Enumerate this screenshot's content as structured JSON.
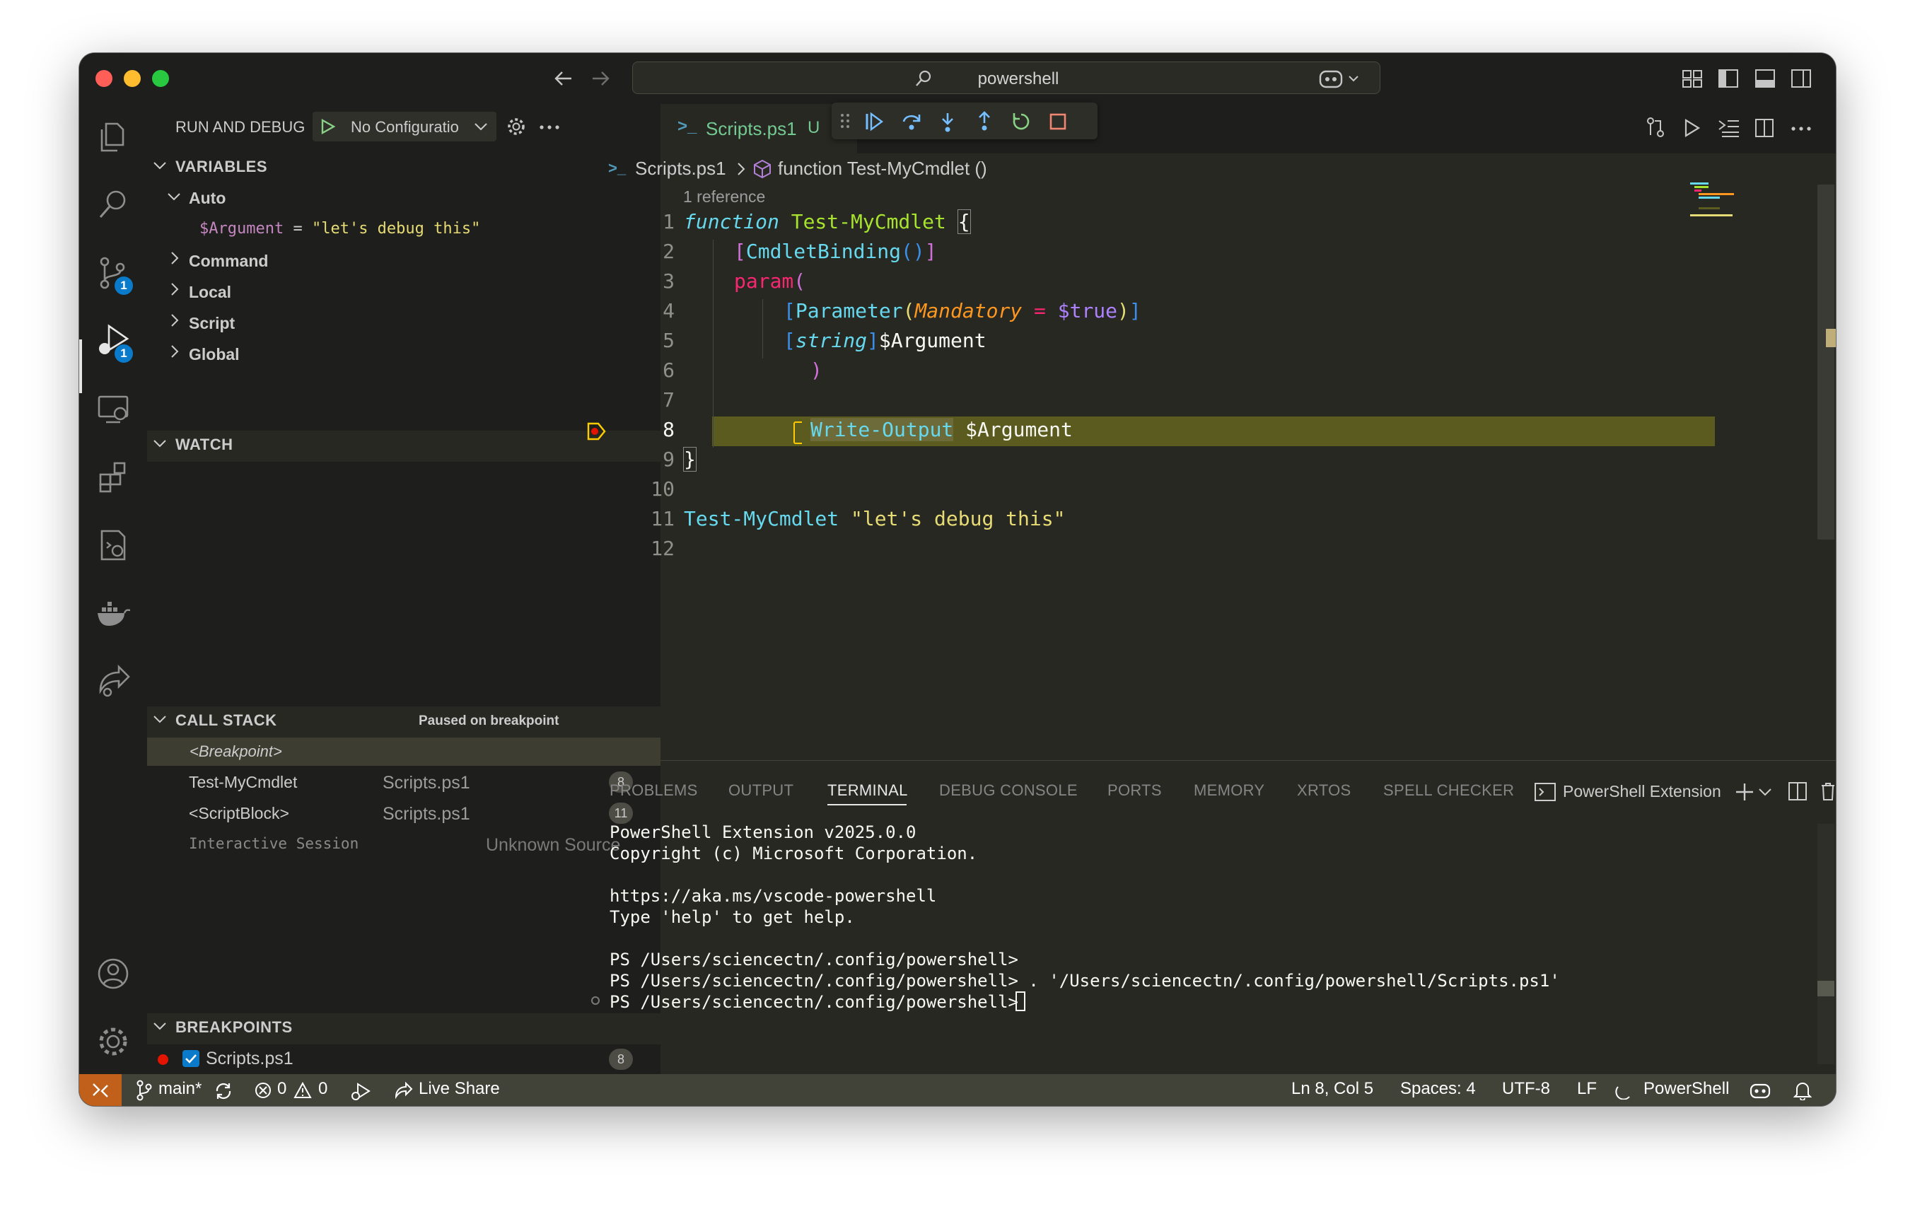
{
  "titlebar": {
    "search_label": "powershell",
    "colors": {
      "close": "#ff5f57",
      "minimize": "#febc2e",
      "maximize": "#28c840"
    }
  },
  "activity_bar": {
    "items": [
      {
        "name": "explorer-icon"
      },
      {
        "name": "search-icon"
      },
      {
        "name": "source-control-icon",
        "badge": "1"
      },
      {
        "name": "run-debug-icon",
        "badge": "1"
      },
      {
        "name": "remote-explorer-icon"
      },
      {
        "name": "extensions-icon"
      },
      {
        "name": "powershell-commands-icon"
      },
      {
        "name": "docker-icon"
      },
      {
        "name": "live-share-icon"
      },
      {
        "name": "accounts-icon"
      },
      {
        "name": "manage-gear-icon"
      }
    ]
  },
  "run_debug": {
    "title": "RUN AND DEBUG",
    "config": "No Configuratio"
  },
  "variables": {
    "title": "VARIABLES",
    "auto_label": "Auto",
    "auto_var_name": "$Argument",
    "auto_var_eq": " = ",
    "auto_var_value": "\"let's debug this\"",
    "scopes": [
      "Command",
      "Local",
      "Script",
      "Global"
    ]
  },
  "watch": {
    "title": "WATCH"
  },
  "call_stack": {
    "title": "CALL STACK",
    "status": "Paused on breakpoint",
    "breakpoint_frame": "<Breakpoint>",
    "frames": [
      {
        "name": "Test-MyCmdlet",
        "file": "Scripts.ps1",
        "line": "8"
      },
      {
        "name": "<ScriptBlock>",
        "file": "Scripts.ps1",
        "line": "11"
      },
      {
        "name": "Interactive Session",
        "file": "Unknown Source",
        "line": ""
      }
    ]
  },
  "breakpoints": {
    "title": "BREAKPOINTS",
    "items": [
      {
        "file": "Scripts.ps1",
        "line": "8"
      }
    ]
  },
  "editor": {
    "tab_label": "Scripts.ps1",
    "tab_status": "U",
    "breadcrumb_file": "Scripts.ps1",
    "breadcrumb_symbol": "function Test-MyCmdlet ()",
    "codelens": "1 reference",
    "line_numbers": [
      "1",
      "2",
      "3",
      "4",
      "5",
      "6",
      "7",
      "8",
      "9",
      "10",
      "11",
      "12"
    ],
    "code": {
      "l1_kw": "function",
      "l1_name": "Test-MyCmdlet",
      "l1_brace": "{",
      "l2_open": "[",
      "l2_attr": "CmdletBinding",
      "l2_parens": "()",
      "l2_close": "]",
      "l3_kw": "param",
      "l3_paren": "(",
      "l4_open": "[",
      "l4_attr": "Parameter",
      "l4_p1": "(",
      "l4_arg": "Mandatory",
      "l4_eq": " = ",
      "l4_val": "$true",
      "l4_p2": ")",
      "l4_close": "]",
      "l5_open": "[",
      "l5_type": "string",
      "l5_close": "]",
      "l5_var": "$Argument",
      "l6_paren": ")",
      "l8_cmd": "Write-Output",
      "l8_var": " $Argument",
      "l9_brace": "}",
      "l11_cmd": "Test-MyCmdlet",
      "l11_str": " \"let's debug this\""
    },
    "colors": {
      "keyword": "#66d9ef",
      "function": "#a6e22e",
      "string": "#e6db74",
      "variable": "#f8f8f2",
      "orange": "#fd971f",
      "pink": "#f92672",
      "highlight": "#5b5b1f"
    }
  },
  "panel": {
    "tabs": [
      "PROBLEMS",
      "OUTPUT",
      "TERMINAL",
      "DEBUG CONSOLE",
      "PORTS",
      "MEMORY",
      "XRTOS",
      "SPELL CHECKER"
    ],
    "active_tab": "TERMINAL",
    "terminal_name": "PowerShell Extension",
    "terminal_lines": [
      "PowerShell Extension v2025.0.0",
      "Copyright (c) Microsoft Corporation.",
      "",
      "https://aka.ms/vscode-powershell",
      "Type 'help' to get help.",
      "",
      "PS /Users/sciencectn/.config/powershell>",
      "PS /Users/sciencectn/.config/powershell> . '/Users/sciencectn/.config/powershell/Scripts.ps1'",
      "PS /Users/sciencectn/.config/powershell> "
    ]
  },
  "statusbar": {
    "branch": "main*",
    "errors": "0",
    "warnings": "0",
    "live_share": "Live Share",
    "position": "Ln 8, Col 5",
    "spaces": "Spaces: 4",
    "encoding": "UTF-8",
    "eol": "LF",
    "language": "PowerShell"
  }
}
